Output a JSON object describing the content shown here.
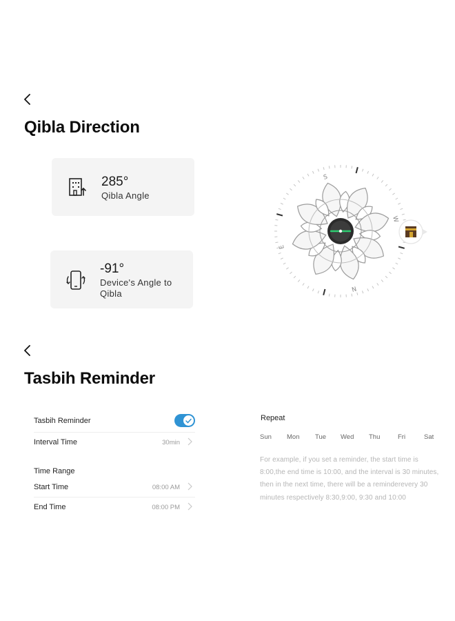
{
  "qibla": {
    "title": "Qibla Direction",
    "qibla_angle": {
      "value": "285°",
      "label": "Qibla Angle",
      "icon": "building-arrow-icon"
    },
    "device_angle": {
      "value": "-91°",
      "label": "Device's Angle to Qibla",
      "icon": "phone-rotate-icon"
    },
    "compass": {
      "labels": [
        "S",
        "W",
        "E",
        "N"
      ],
      "accent": "#2ecc71",
      "kaaba_icon": "kaaba-icon"
    }
  },
  "tasbih": {
    "title": "Tasbih Reminder",
    "reminder_label": "Tasbih Reminder",
    "reminder_enabled": true,
    "interval_label": "Interval Time",
    "interval_value": "30min",
    "time_range_label": "Time Range",
    "start_label": "Start Time",
    "start_value": "08:00 AM",
    "end_label": "End Time",
    "end_value": "08:00 PM",
    "repeat_label": "Repeat",
    "days": [
      "Sun",
      "Mon",
      "Tue",
      "Wed",
      "Thu",
      "Fri",
      "Sat"
    ],
    "example_text": "For example, if you set a reminder, the start time is 8:00,the end time is 10:00, and the interval is 30 minutes, then in the next time, there will be a reminderevery 30 minutes respectively 8:30,9:00, 9:30 and 10:00",
    "toggle_color": "#2f93d4"
  }
}
